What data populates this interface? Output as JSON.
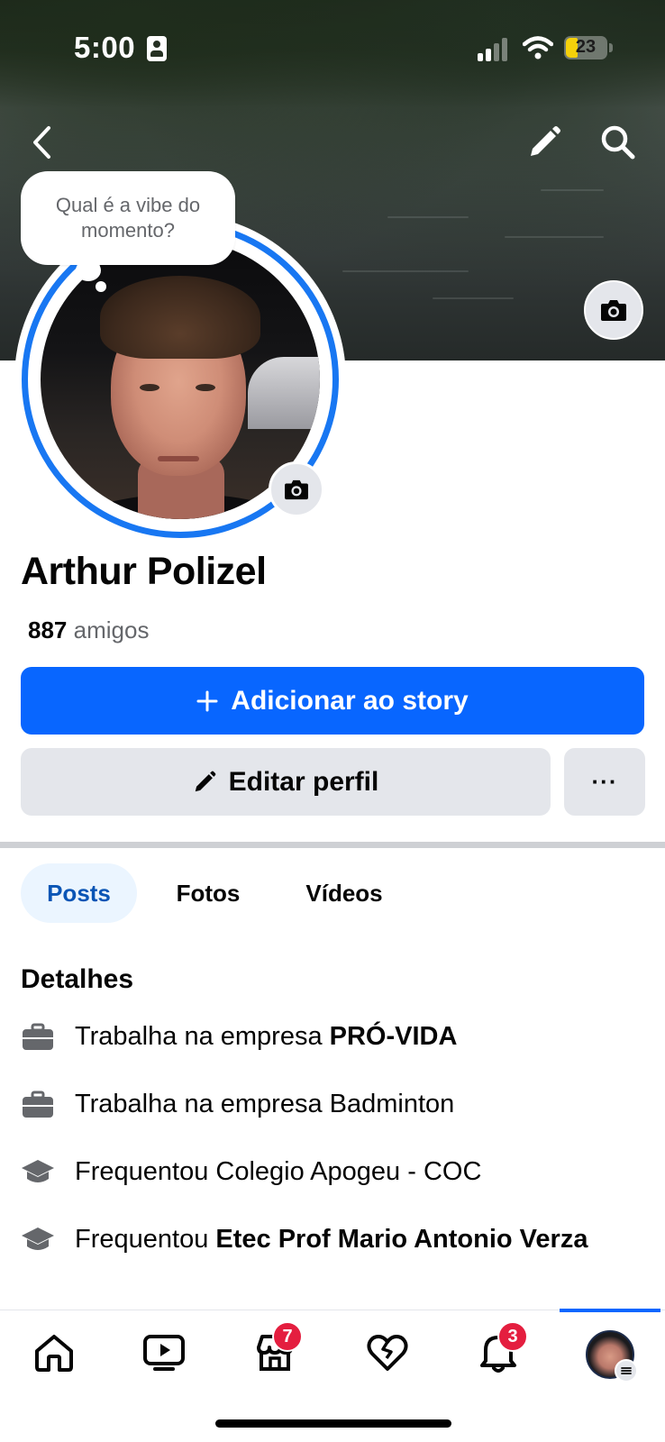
{
  "status_bar": {
    "time": "5:00",
    "battery_level": "23",
    "battery_color": "#f5d10a"
  },
  "header": {
    "icons": [
      "chevron-left-icon",
      "pencil-icon",
      "search-icon",
      "camera-icon"
    ]
  },
  "profile": {
    "bubble_text": "Qual é a vibe do momento?",
    "name": "Arthur Polizel",
    "friends_count": "887",
    "friends_label": "amigos"
  },
  "actions": {
    "add_story_label": "Adicionar ao story",
    "edit_profile_label": "Editar perfil",
    "more_label": "···"
  },
  "tabs": [
    {
      "label": "Posts",
      "active": true
    },
    {
      "label": "Fotos",
      "active": false
    },
    {
      "label": "Vídeos",
      "active": false
    }
  ],
  "details": {
    "title": "Detalhes",
    "items": [
      {
        "icon": "briefcase-icon",
        "prefix": "Trabalha na empresa ",
        "bold": "PRÓ-VIDA"
      },
      {
        "icon": "briefcase-icon",
        "prefix": "Trabalha na empresa Badminton",
        "bold": ""
      },
      {
        "icon": "graduation-cap-icon",
        "prefix": "Frequentou Colegio Apogeu - COC",
        "bold": ""
      },
      {
        "icon": "graduation-cap-icon",
        "prefix": "Frequentou ",
        "bold": "Etec Prof Mario Antonio Verza"
      }
    ]
  },
  "bottom_nav": {
    "items": [
      {
        "name": "home",
        "icon": "home-icon",
        "badge": ""
      },
      {
        "name": "video",
        "icon": "video-icon",
        "badge": ""
      },
      {
        "name": "marketplace",
        "icon": "marketplace-icon",
        "badge": "7"
      },
      {
        "name": "dating",
        "icon": "heart-icon",
        "badge": ""
      },
      {
        "name": "notifications",
        "icon": "bell-icon",
        "badge": "3"
      },
      {
        "name": "profile",
        "icon": "avatar-icon",
        "badge": ""
      }
    ],
    "accent_color": "#0866ff",
    "badge_color": "#e41e3f"
  }
}
